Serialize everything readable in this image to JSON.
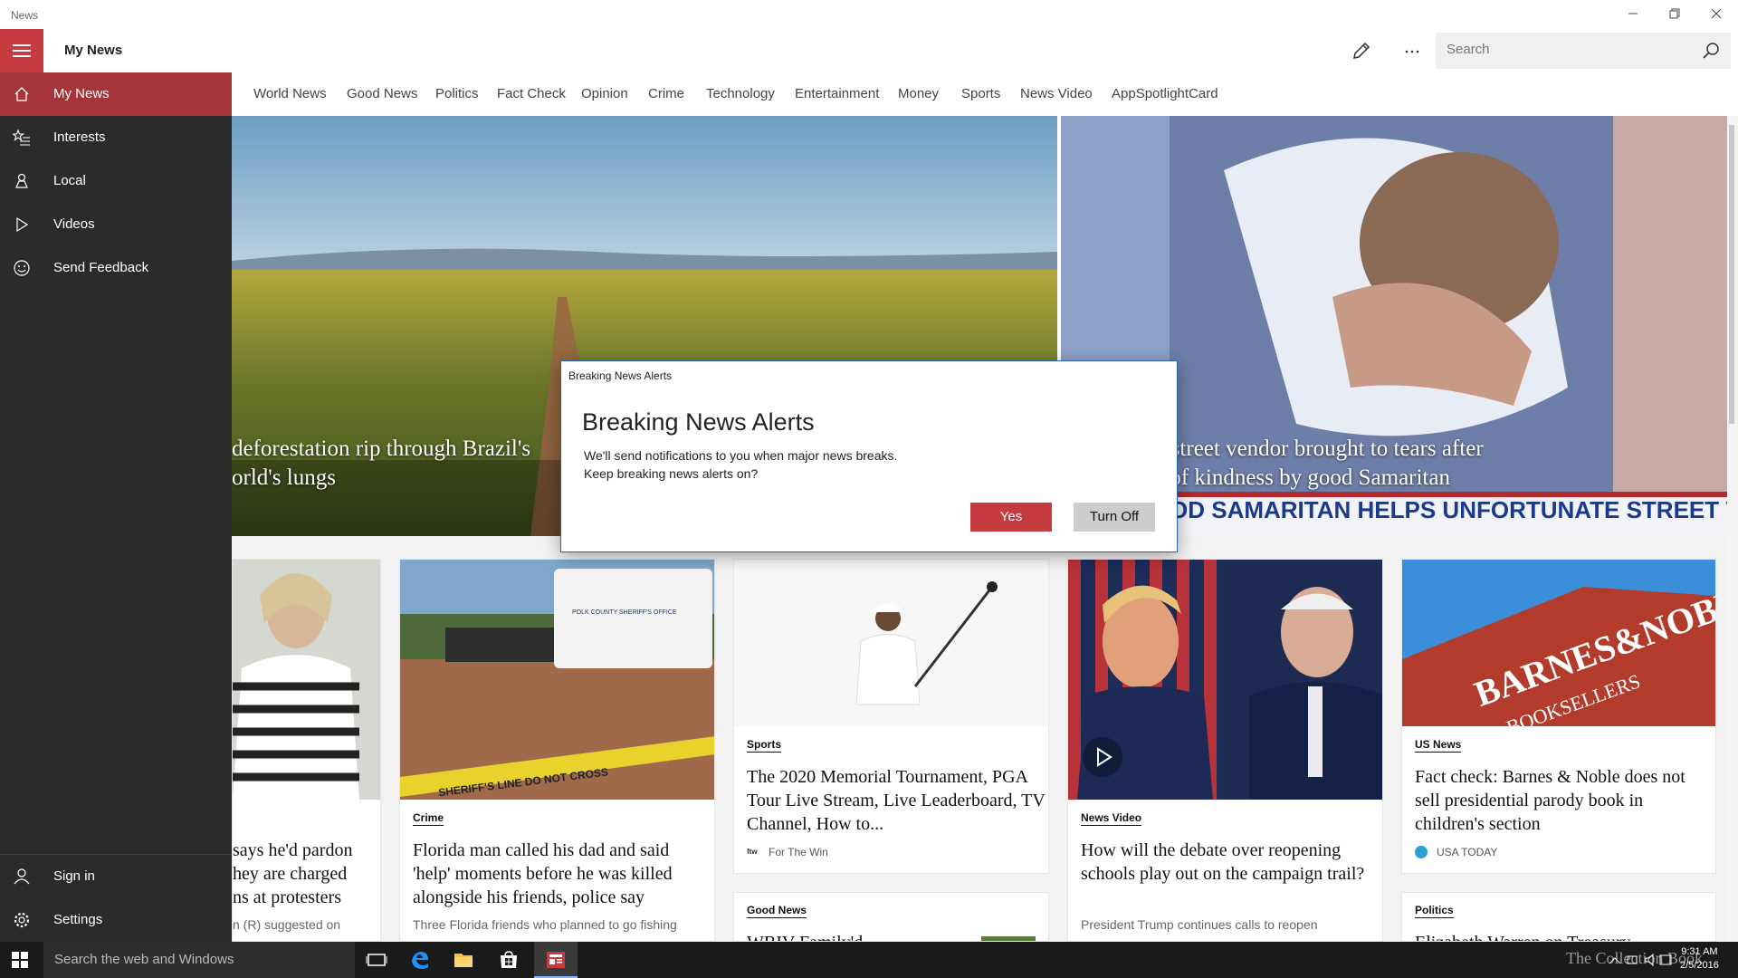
{
  "window": {
    "title": "News"
  },
  "app": {
    "title": "My News",
    "search_placeholder": "Search"
  },
  "sidebar": {
    "items": [
      {
        "label": "My News",
        "icon": "home-icon",
        "active": true
      },
      {
        "label": "Interests",
        "icon": "star-list-icon"
      },
      {
        "label": "Local",
        "icon": "person-pin-icon"
      },
      {
        "label": "Videos",
        "icon": "play-icon"
      },
      {
        "label": "Send Feedback",
        "icon": "smiley-icon"
      }
    ],
    "bottom": [
      {
        "label": "Sign in",
        "icon": "person-icon"
      },
      {
        "label": "Settings",
        "icon": "gear-icon"
      }
    ]
  },
  "tabs": [
    "World News",
    "Good News",
    "Politics",
    "Fact Check",
    "Opinion",
    "Crime",
    "Technology",
    "Entertainment",
    "Money",
    "Sports",
    "News Video",
    "AppSpotlightCard"
  ],
  "hero": [
    {
      "caption_line1": "deforestation rip through Brazil's",
      "caption_line2": "orld's lungs"
    },
    {
      "caption_line1": "ld street vendor brought to tears after",
      "caption_line2": "ct of kindness by good Samaritan",
      "banner": "OD SAMARITAN HELPS UNFORTUNATE STREET VEND"
    }
  ],
  "cards": [
    {
      "headline": "says he'd pardon\nhey are charged\nns at protesters",
      "desc": "n (R) suggested on"
    },
    {
      "category": "Crime",
      "headline": "Florida man called his dad and said 'help' moments before he was killed alongside his friends, police say",
      "desc": "Three Florida friends who planned to go fishing",
      "img_text": "POLK COUNTY SHERIFF'S OFFICE",
      "tape_text": "SHERIFF'S LINE DO NOT CROSS"
    },
    {
      "category": "Sports",
      "headline": "The 2020 Memorial Tournament, PGA Tour Live Stream, Live Leaderboard, TV Channel, How to...",
      "source": "For The Win",
      "source_mark": "ftw"
    },
    {
      "category": "News Video",
      "headline": "How will the debate over reopening schools play out on the campaign trail?",
      "desc": "President Trump continues calls to reopen"
    },
    {
      "category": "US News",
      "headline": "Fact check: Barnes & Noble does not sell presidential parody book in children's section",
      "source": "USA TODAY",
      "img_text1": "BARNES&NOBLE",
      "img_text2": "BOOKSELLERS"
    },
    {
      "category": "Good News",
      "headline": "WBIV Family'd..."
    },
    {
      "category": "Politics",
      "headline": "Elizabeth Warren on Treasury..."
    }
  ],
  "dialog": {
    "window_title": "Breaking News Alerts",
    "title": "Breaking News Alerts",
    "message_line1": "We'll send notifications to you when major news breaks.",
    "message_line2": "Keep breaking news alerts on?",
    "yes_label": "Yes",
    "off_label": "Turn Off"
  },
  "taskbar": {
    "search_text": "Search the web and Windows",
    "time": "9:31 AM",
    "date": "2/5/2016",
    "watermark": "The Collection Book"
  },
  "colors": {
    "accent": "#c53b3f",
    "sidebar_bg": "#2b2b2b",
    "active_item": "#a5343b"
  }
}
